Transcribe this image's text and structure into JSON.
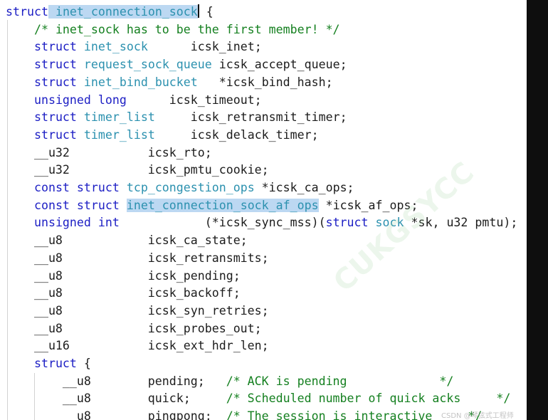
{
  "window": {
    "background": "#ffffff",
    "right_strip_color": "#0e0e0e"
  },
  "syntax_colors": {
    "keyword": "#1c1ec4",
    "type": "#2c91af",
    "comment": "#158020",
    "plain": "#1c1c1c",
    "selection": "#bcd8f2"
  },
  "editor": {
    "lines": [
      [
        {
          "t": "kw",
          "v": "struct"
        },
        {
          "t": "sel",
          "v": " "
        },
        {
          "t": "sel-ty",
          "v": "inet_connection_sock"
        },
        {
          "t": "cursor",
          "v": ""
        },
        {
          "t": "pl",
          "v": " {"
        }
      ],
      [
        {
          "t": "pl",
          "v": "    "
        },
        {
          "t": "cm",
          "v": "/* inet_sock has to be the first member! */"
        }
      ],
      [
        {
          "t": "pl",
          "v": "    "
        },
        {
          "t": "kw",
          "v": "struct"
        },
        {
          "t": "pl",
          "v": " "
        },
        {
          "t": "ty",
          "v": "inet_sock"
        },
        {
          "t": "pl",
          "v": "      icsk_inet;"
        }
      ],
      [
        {
          "t": "pl",
          "v": "    "
        },
        {
          "t": "kw",
          "v": "struct"
        },
        {
          "t": "pl",
          "v": " "
        },
        {
          "t": "ty",
          "v": "request_sock_queue"
        },
        {
          "t": "pl",
          "v": " icsk_accept_queue;"
        }
      ],
      [
        {
          "t": "pl",
          "v": "    "
        },
        {
          "t": "kw",
          "v": "struct"
        },
        {
          "t": "pl",
          "v": " "
        },
        {
          "t": "ty",
          "v": "inet_bind_bucket"
        },
        {
          "t": "pl",
          "v": "   *icsk_bind_hash;"
        }
      ],
      [
        {
          "t": "pl",
          "v": "    "
        },
        {
          "t": "kw",
          "v": "unsigned long"
        },
        {
          "t": "pl",
          "v": "      icsk_timeout;"
        }
      ],
      [
        {
          "t": "pl",
          "v": "    "
        },
        {
          "t": "kw",
          "v": "struct"
        },
        {
          "t": "pl",
          "v": " "
        },
        {
          "t": "ty",
          "v": "timer_list"
        },
        {
          "t": "pl",
          "v": "     icsk_retransmit_timer;"
        }
      ],
      [
        {
          "t": "pl",
          "v": "    "
        },
        {
          "t": "kw",
          "v": "struct"
        },
        {
          "t": "pl",
          "v": " "
        },
        {
          "t": "ty",
          "v": "timer_list"
        },
        {
          "t": "pl",
          "v": "     icsk_delack_timer;"
        }
      ],
      [
        {
          "t": "pl",
          "v": "    __u32           icsk_rto;"
        }
      ],
      [
        {
          "t": "pl",
          "v": "    __u32           icsk_pmtu_cookie;"
        }
      ],
      [
        {
          "t": "pl",
          "v": "    "
        },
        {
          "t": "kw",
          "v": "const struct"
        },
        {
          "t": "pl",
          "v": " "
        },
        {
          "t": "ty",
          "v": "tcp_congestion_ops"
        },
        {
          "t": "pl",
          "v": " *icsk_ca_ops;"
        }
      ],
      [
        {
          "t": "pl",
          "v": "    "
        },
        {
          "t": "kw",
          "v": "const struct"
        },
        {
          "t": "pl",
          "v": " "
        },
        {
          "t": "sel-ty",
          "v": "inet_connection_sock_af_ops"
        },
        {
          "t": "pl",
          "v": " *icsk_af_ops;"
        }
      ],
      [
        {
          "t": "pl",
          "v": "    "
        },
        {
          "t": "kw",
          "v": "unsigned int"
        },
        {
          "t": "pl",
          "v": "            (*icsk_sync_mss)("
        },
        {
          "t": "kw",
          "v": "struct"
        },
        {
          "t": "pl",
          "v": " "
        },
        {
          "t": "ty",
          "v": "sock"
        },
        {
          "t": "pl",
          "v": " *sk, u32 pmtu);"
        }
      ],
      [
        {
          "t": "pl",
          "v": "    __u8            icsk_ca_state;"
        }
      ],
      [
        {
          "t": "pl",
          "v": "    __u8            icsk_retransmits;"
        }
      ],
      [
        {
          "t": "pl",
          "v": "    __u8            icsk_pending;"
        }
      ],
      [
        {
          "t": "pl",
          "v": "    __u8            icsk_backoff;"
        }
      ],
      [
        {
          "t": "pl",
          "v": "    __u8            icsk_syn_retries;"
        }
      ],
      [
        {
          "t": "pl",
          "v": "    __u8            icsk_probes_out;"
        }
      ],
      [
        {
          "t": "pl",
          "v": "    __u16           icsk_ext_hdr_len;"
        }
      ],
      [
        {
          "t": "pl",
          "v": "    "
        },
        {
          "t": "kw",
          "v": "struct"
        },
        {
          "t": "pl",
          "v": " {"
        }
      ],
      [
        {
          "t": "pl",
          "v": "        __u8        pending;   "
        },
        {
          "t": "cm",
          "v": "/* ACK is pending             */"
        }
      ],
      [
        {
          "t": "pl",
          "v": "        __u8        quick;     "
        },
        {
          "t": "cm",
          "v": "/* Scheduled number of quick acks     */"
        }
      ],
      [
        {
          "t": "pl",
          "v": "        __u8        pingpong;  "
        },
        {
          "t": "cm",
          "v": "/* The session is interactive     */"
        }
      ]
    ]
  },
  "watermarks": {
    "diagonal": "CUKGSYCC",
    "footer": "CSDN @琴弦式工程师"
  }
}
